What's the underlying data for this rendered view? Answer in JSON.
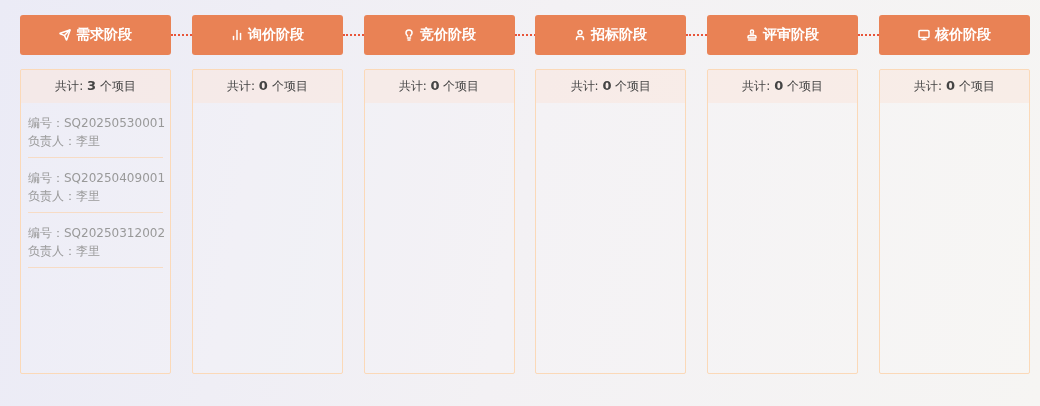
{
  "stages": [
    {
      "kind": "send",
      "title": "需求阶段",
      "count": "共计: **3** 个项目",
      "items": [
        {
          "code": "编号：SQ20250530001",
          "owner": "负责人：李里"
        },
        {
          "code": "编号：SQ20250409001",
          "owner": "负责人：李里"
        },
        {
          "code": "编号：SQ20250312002",
          "owner": "负责人：李里"
        }
      ]
    },
    {
      "kind": "chart",
      "title": "询价阶段",
      "count": "共计: **0** 个项目"
    },
    {
      "kind": "bulb",
      "title": "竞价阶段",
      "count": "共计: **0** 个项目"
    },
    {
      "kind": "user",
      "title": "招标阶段",
      "count": "共计: **0** 个项目"
    },
    {
      "kind": "stamp",
      "title": "评审阶段",
      "count": "共计: **0** 个项目"
    },
    {
      "kind": "monitor",
      "title": "核价阶段",
      "count": "共计: **0** 个项目"
    }
  ]
}
